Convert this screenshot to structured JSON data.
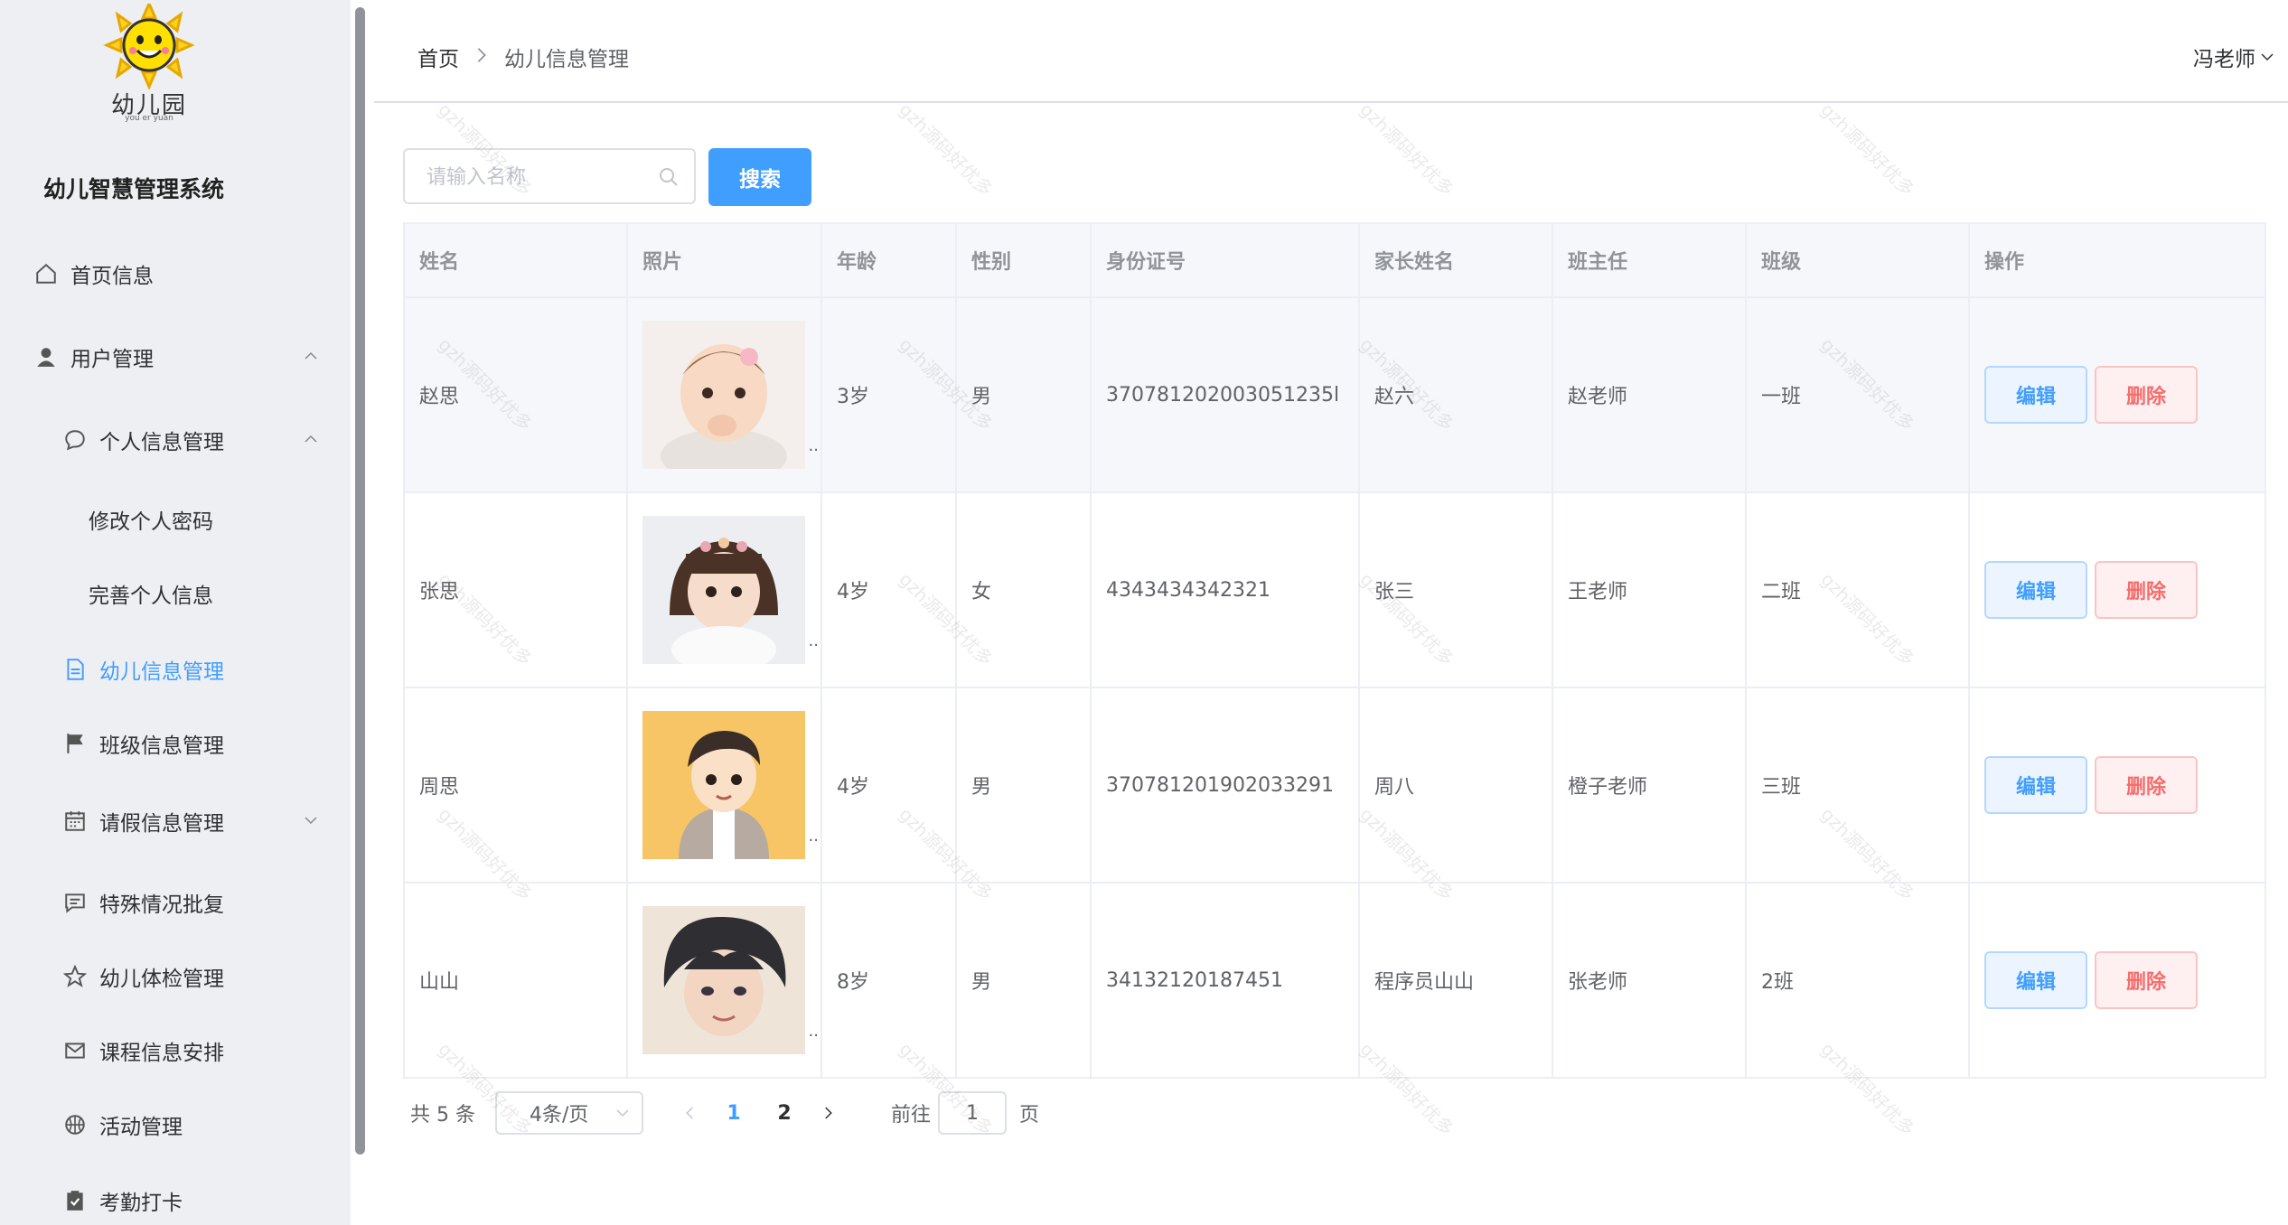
{
  "sidebar": {
    "logo_text": "幼儿园",
    "logo_sub": "you er yuan",
    "system_title": "幼儿智慧管理系统",
    "items": [
      {
        "label": "首页信息"
      },
      {
        "label": "用户管理"
      },
      {
        "label": "个人信息管理"
      },
      {
        "label": "修改个人密码"
      },
      {
        "label": "完善个人信息"
      },
      {
        "label": "幼儿信息管理"
      },
      {
        "label": "班级信息管理"
      },
      {
        "label": "请假信息管理"
      },
      {
        "label": "特殊情况批复"
      },
      {
        "label": "幼儿体检管理"
      },
      {
        "label": "课程信息安排"
      },
      {
        "label": "活动管理"
      },
      {
        "label": "考勤打卡"
      }
    ]
  },
  "header": {
    "breadcrumb": [
      "首页",
      "幼儿信息管理"
    ],
    "user": "冯老师"
  },
  "search": {
    "placeholder": "请输入名称",
    "button": "搜索"
  },
  "table": {
    "columns": [
      "姓名",
      "照片",
      "年龄",
      "性别",
      "身份证号",
      "家长姓名",
      "班主任",
      "班级",
      "操作"
    ],
    "rows": [
      {
        "name": "赵思",
        "age": "3岁",
        "gender": "男",
        "id": "370781202003051235l",
        "parent": "赵六",
        "teacher": "赵老师",
        "class": "一班"
      },
      {
        "name": "张思",
        "age": "4岁",
        "gender": "女",
        "id": "4343434342321",
        "parent": "张三",
        "teacher": "王老师",
        "class": "二班"
      },
      {
        "name": "周思",
        "age": "4岁",
        "gender": "男",
        "id": "370781201902033291",
        "parent": "周八",
        "teacher": "橙子老师",
        "class": "三班"
      },
      {
        "name": "山山",
        "age": "8岁",
        "gender": "男",
        "id": "34132120187451",
        "parent": "程序员山山",
        "teacher": "张老师",
        "class": "2班"
      }
    ],
    "edit_label": "编辑",
    "delete_label": "删除",
    "ellipsis": ".."
  },
  "pagination": {
    "total": "共 5 条",
    "page_size": "4条/页",
    "pages": [
      "1",
      "2"
    ],
    "goto_prefix": "前往",
    "goto_value": "1",
    "goto_suffix": "页"
  },
  "watermark": "gzh源码好优多",
  "colors": {
    "primary": "#409eff",
    "danger": "#f56c6c",
    "sidebar_bg": "#eeeff3"
  }
}
